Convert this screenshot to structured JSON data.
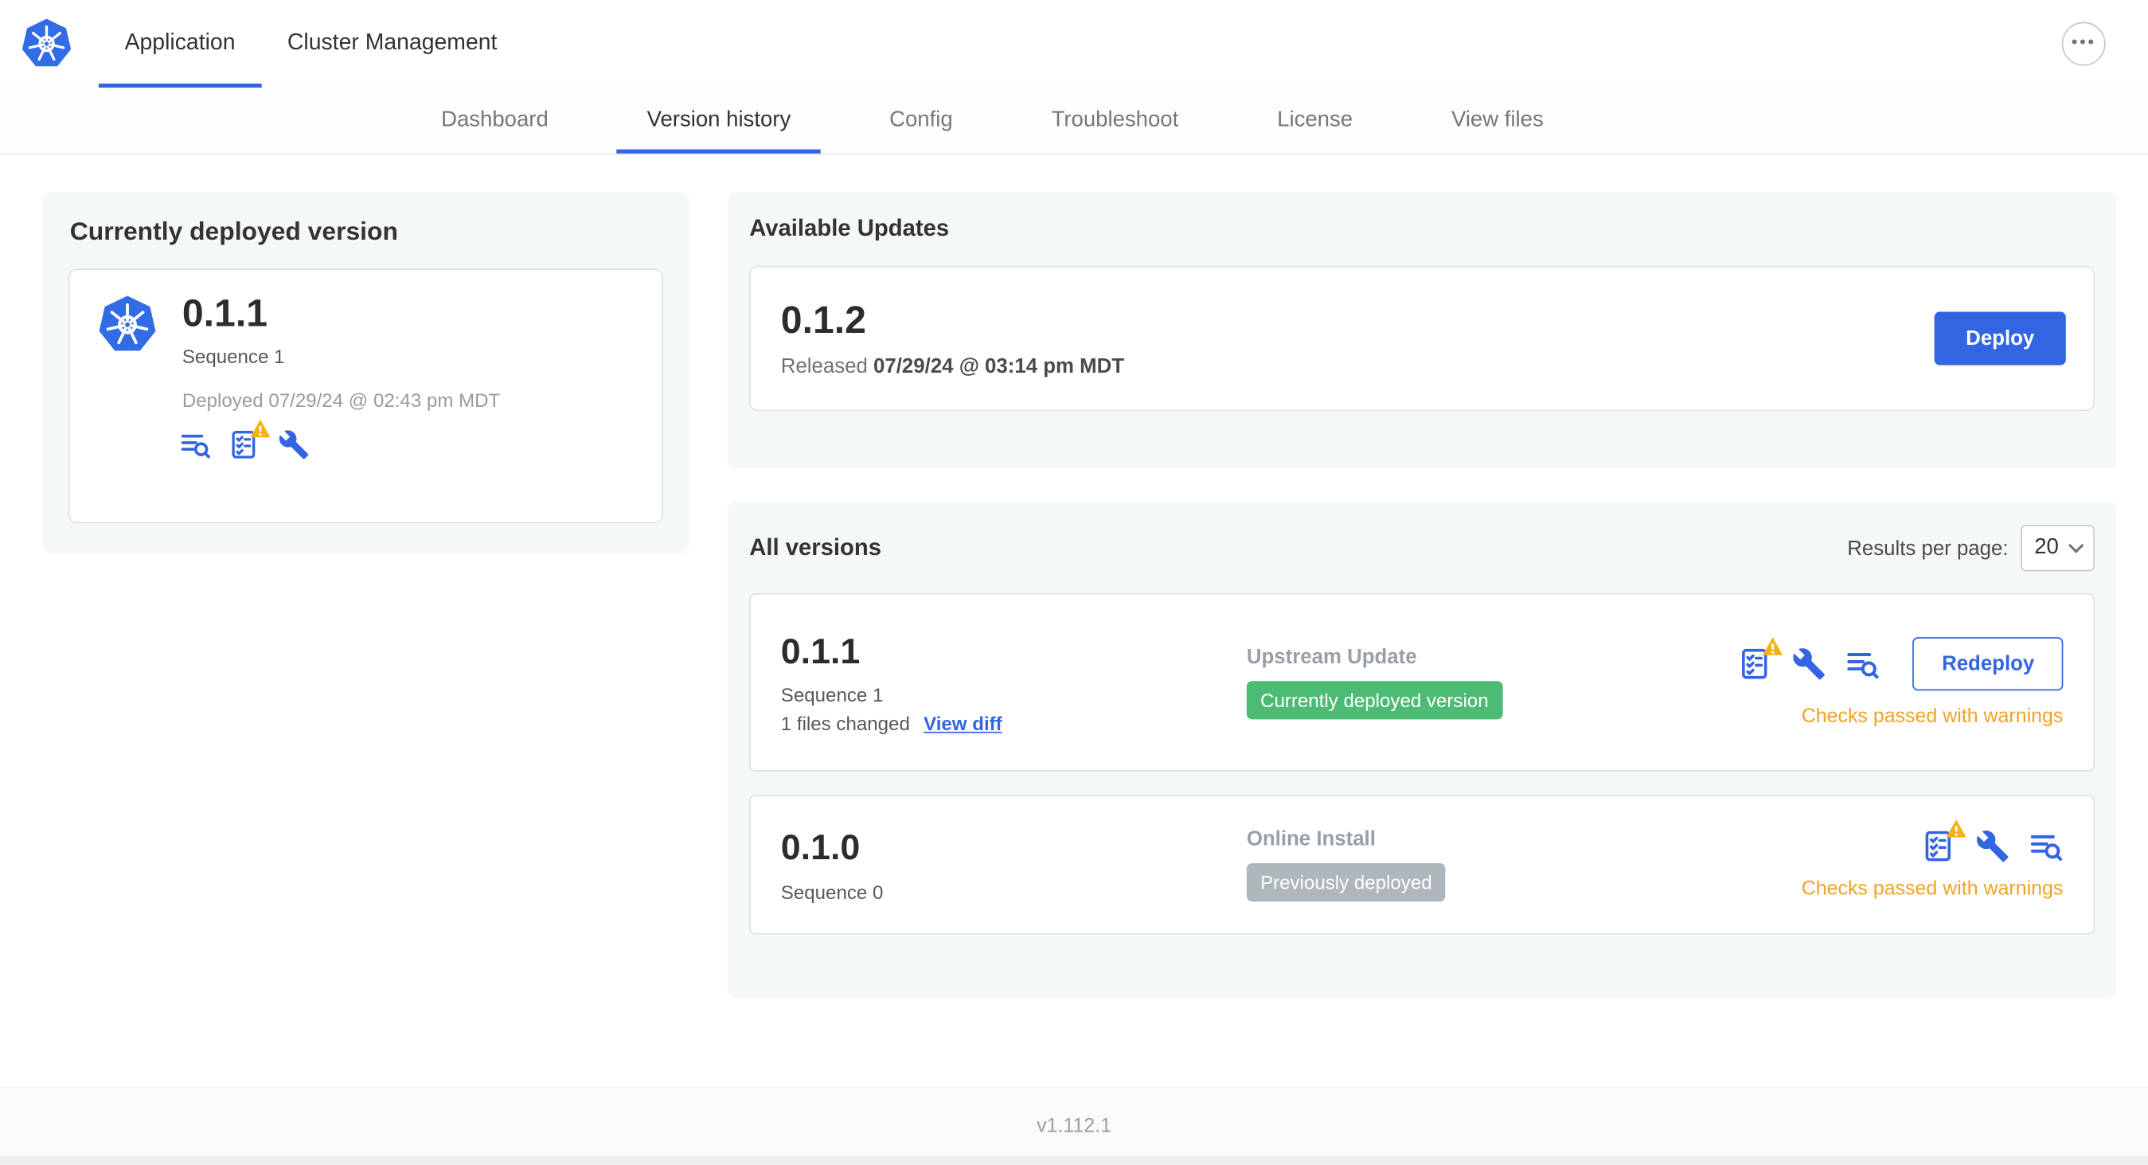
{
  "colors": {
    "accent_blue": "#3365E3",
    "k8s_blue": "#326CE5",
    "warning_orange": "#EFA324",
    "warning_triangle": "#F5B017",
    "badge_green": "#4CBB73",
    "badge_gray": "#AFB7BC"
  },
  "header": {
    "tabs": [
      {
        "label": "Application",
        "active": true
      },
      {
        "label": "Cluster Management",
        "active": false
      }
    ]
  },
  "subnav": {
    "tabs": [
      {
        "label": "Dashboard",
        "active": false
      },
      {
        "label": "Version history",
        "active": true
      },
      {
        "label": "Config",
        "active": false
      },
      {
        "label": "Troubleshoot",
        "active": false
      },
      {
        "label": "License",
        "active": false
      },
      {
        "label": "View files",
        "active": false
      }
    ]
  },
  "current_version": {
    "title": "Currently deployed version",
    "version": "0.1.1",
    "sequence": "Sequence 1",
    "deployed_text": "Deployed 07/29/24 @ 02:43 pm MDT"
  },
  "available_updates": {
    "title": "Available Updates",
    "version": "0.1.2",
    "released_prefix": "Released",
    "released_date": "07/29/24 @ 03:14 pm MDT",
    "deploy_button": "Deploy"
  },
  "all_versions": {
    "title": "All versions",
    "results_per_page_label": "Results per page:",
    "results_per_page_value": "20",
    "rows": [
      {
        "version": "0.1.1",
        "sequence": "Sequence 1",
        "files_changed": "1 files changed",
        "view_diff_label": "View diff",
        "source": "Upstream Update",
        "badge_label": "Currently deployed version",
        "status_text": "Checks passed with warnings",
        "action_label": "Redeploy"
      },
      {
        "version": "0.1.0",
        "sequence": "Sequence 0",
        "source": "Online Install",
        "badge_label": "Previously deployed",
        "status_text": "Checks passed with warnings"
      }
    ]
  },
  "footer": {
    "app_version": "v1.112.1"
  }
}
